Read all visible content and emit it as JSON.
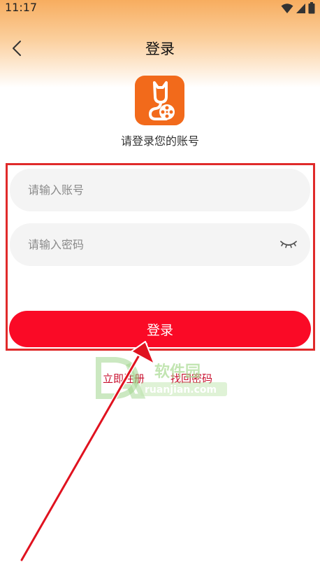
{
  "status_bar": {
    "time": "11:17"
  },
  "header": {
    "title": "登录"
  },
  "logo": {
    "alt": "app-logo"
  },
  "subtitle": "请登录您的账号",
  "form": {
    "account_placeholder": "请输入账号",
    "password_placeholder": "请输入密码",
    "login_label": "登录"
  },
  "links": {
    "register": "立即注册",
    "forgot": "找回密码"
  },
  "watermark": {
    "brand": "软件园",
    "domain": "ruanjian.com"
  },
  "colors": {
    "accent": "#fa0a26",
    "header_gradient_top": "#f7ad5f",
    "logo_bg": "#f26a1b",
    "highlight_border": "#e02a2a"
  }
}
